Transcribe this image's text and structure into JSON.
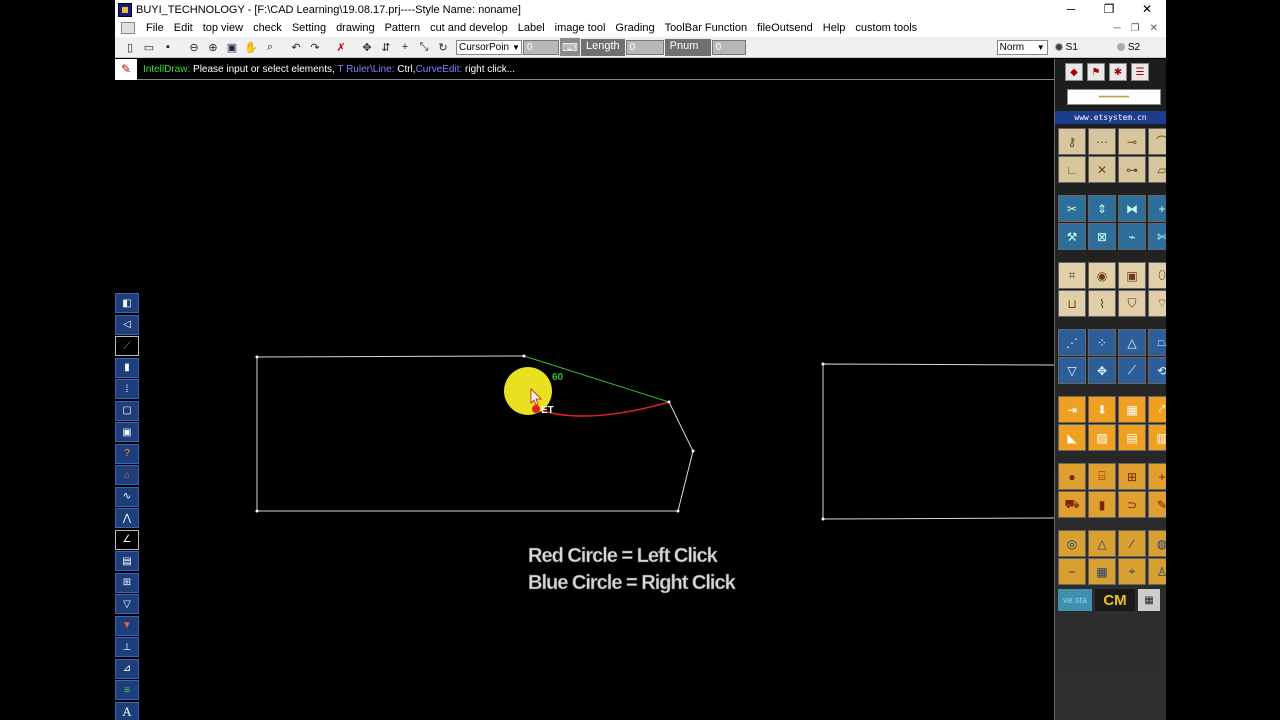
{
  "window": {
    "title": "BUYI_TECHNOLOGY - [F:\\CAD Learning\\19.08.17.prj----Style Name: noname]",
    "minimize": "─",
    "maximize": "❐",
    "close": "✕"
  },
  "menu": {
    "items": [
      "File",
      "Edit",
      "top view",
      "check",
      "Setting",
      "drawing",
      "Pattern",
      "cut and develop",
      "Label",
      "image tool",
      "Grading",
      "ToolBar Function",
      "fileOutsend",
      "Help",
      "custom tools"
    ],
    "child_minimize": "─",
    "child_restore": "❐",
    "child_close": "✕"
  },
  "toolbar": {
    "cursor_select": "CursorPoin",
    "cursor_value": "0",
    "length_label": "Length",
    "length_value": "0",
    "pnum_label": "Pnum",
    "pnum_value": "0",
    "norm_select": "Norm",
    "radio_s1": "S1",
    "radio_s2": "S2"
  },
  "prompt": {
    "mode": "IntellDraw:",
    "message": " Please input or select elements, ",
    "hint1": "T Ruler\\Line:",
    "hint1_rest": " Ctrl,",
    "hint2": "CurveEdit:",
    "hint2_rest": " right click..."
  },
  "canvas": {
    "angle_label": "60",
    "cursor_tag": "ET",
    "caption_line1": "Red Circle = Left Click",
    "caption_line2": "Blue Circle = Right  Click",
    "colors": {
      "pattern_line": "#d8d8d8",
      "guide_line": "#30c030",
      "curve": "#e02020",
      "click_circle": "#e8e020"
    }
  },
  "right_panel": {
    "site": "www.etsystem.cn",
    "cm_label": "CM",
    "vs_label": "ve sta"
  }
}
